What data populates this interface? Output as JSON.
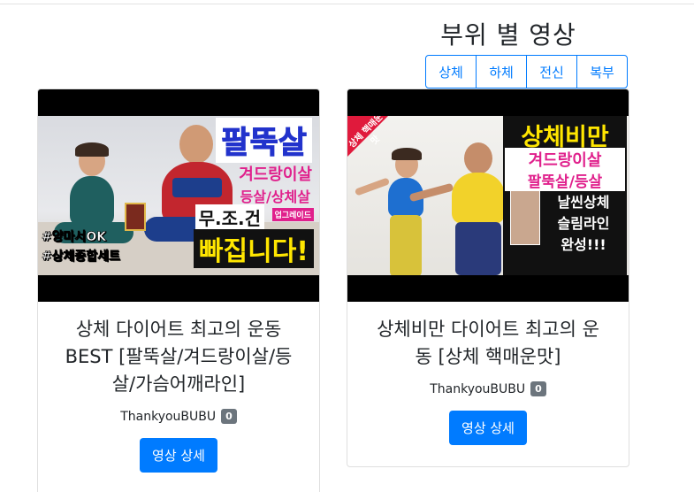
{
  "section": {
    "title": "부위 별 영상"
  },
  "filters": [
    {
      "label": "상체"
    },
    {
      "label": "하체"
    },
    {
      "label": "전신"
    },
    {
      "label": "복부"
    }
  ],
  "cards": [
    {
      "title": "상체 다이어트 최고의 운동 BEST [팔뚝살/겨드랑이살/등살/가슴어깨라인]",
      "channel": "ThankyouBUBU",
      "badge": "0",
      "button": "영상 상세",
      "thumb": {
        "line1": "팔뚝살",
        "line2": "겨드랑이살",
        "line3": "등살/상체살",
        "line4": "무.조.건",
        "upgrade": "업그레이드",
        "line5": "빠집니다!",
        "tag1": "#양마서OK",
        "tag2": "#상체종합세트"
      }
    },
    {
      "title": "상체비만 다이어트 최고의 운동 [상체 핵매운맛]",
      "channel": "ThankyouBUBU",
      "badge": "0",
      "button": "영상 상세",
      "thumb": {
        "line1": "상체비만",
        "line2": "겨드랑이살",
        "line3": "팔뚝살/등살",
        "line4": "날씬상체",
        "line5": "슬림라인",
        "line6": "완성!!!",
        "corner": "상체 핵매운맛"
      }
    }
  ],
  "colors": {
    "primary": "#007bff",
    "badge": "#6c757d"
  }
}
